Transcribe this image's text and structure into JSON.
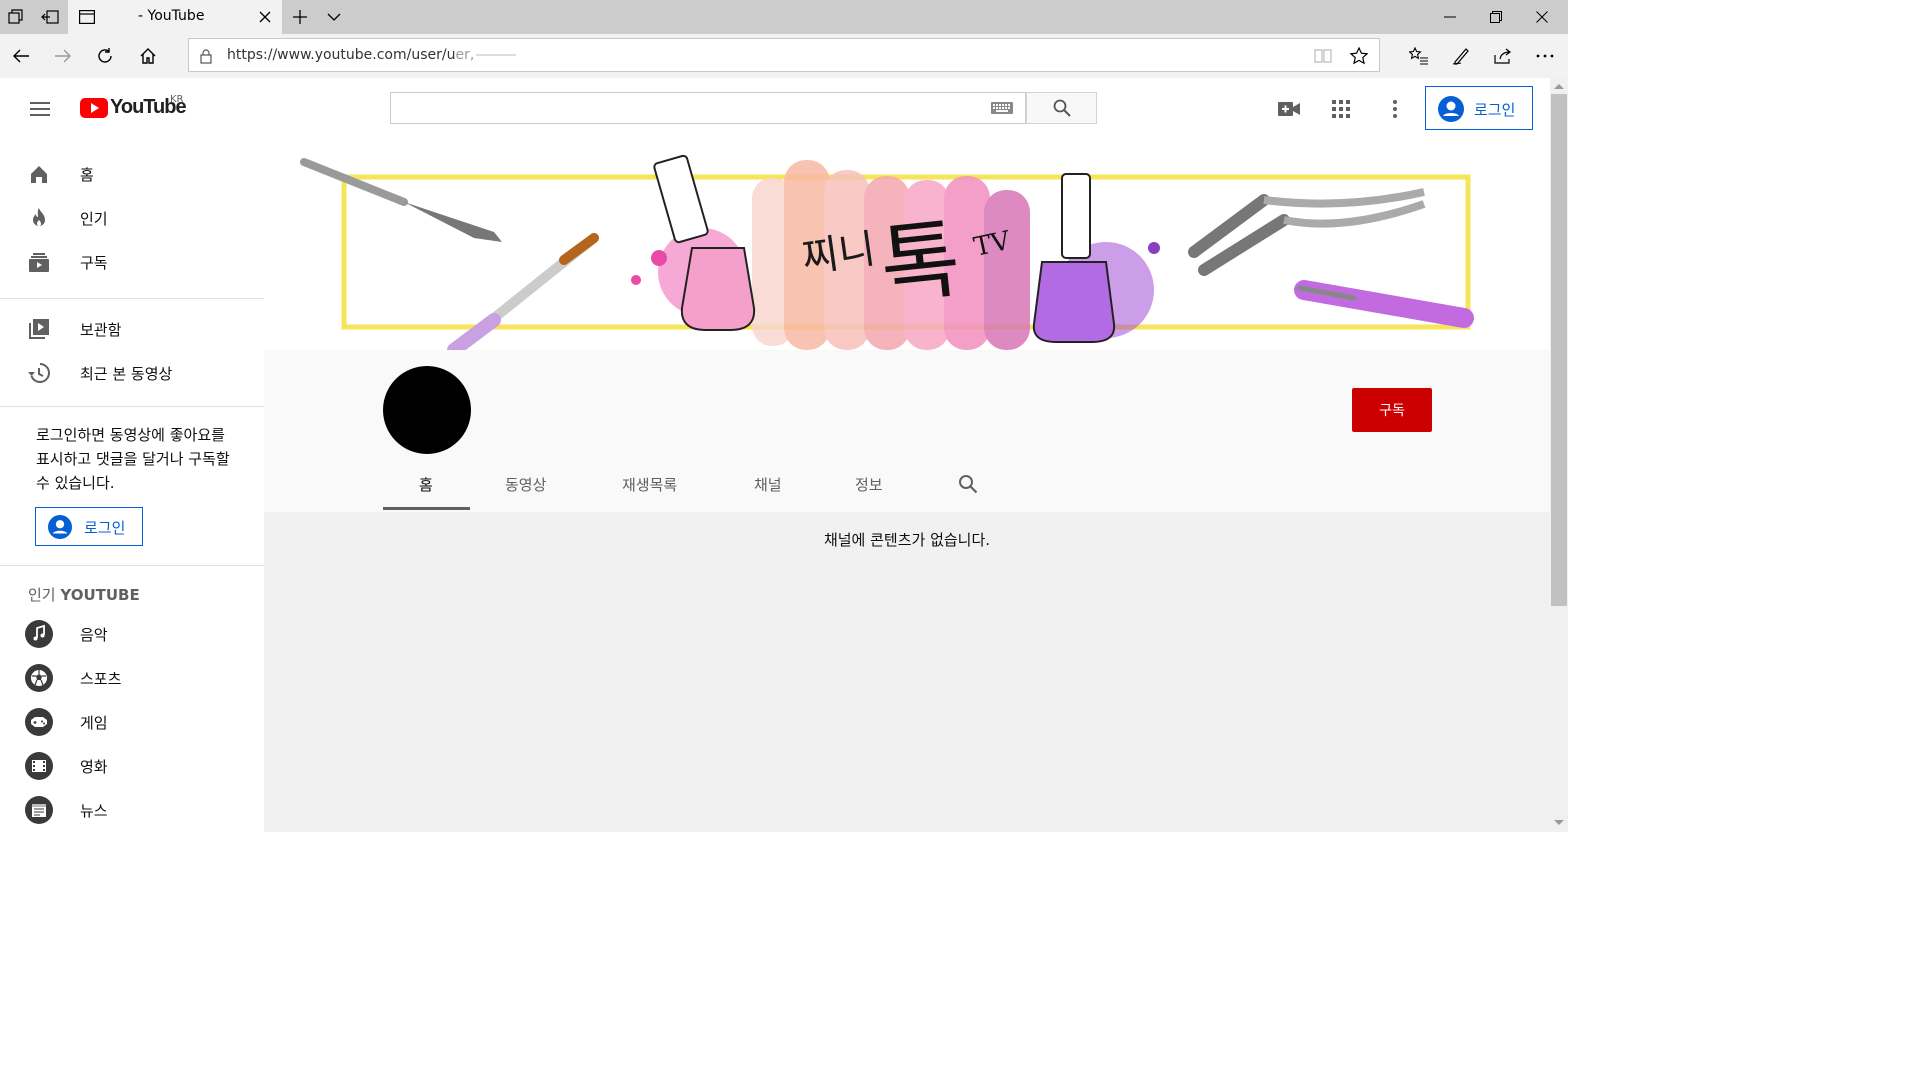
{
  "browser": {
    "tab_title": "- YouTube",
    "url": "https://www.youtube.com/user/u",
    "url_faded": "er,"
  },
  "masthead": {
    "logo_text": "YouTube",
    "region": "KR",
    "search_placeholder": "",
    "signin_label": "로그인"
  },
  "sidebar": {
    "main_items": [
      {
        "label": "홈",
        "icon": "home-icon"
      },
      {
        "label": "인기",
        "icon": "fire-icon"
      },
      {
        "label": "구독",
        "icon": "subscriptions-icon"
      }
    ],
    "library_items": [
      {
        "label": "보관함",
        "icon": "library-icon"
      },
      {
        "label": "최근 본 동영상",
        "icon": "history-icon"
      }
    ],
    "signin_prompt": "로그인하면 동영상에 좋아요를 표시하고 댓글을 달거나 구독할 수 있습니다.",
    "signin_label": "로그인",
    "section_title_prefix": "인기 ",
    "section_title_brand": "YOUTUBE",
    "popular_items": [
      {
        "label": "음악",
        "icon": "music-icon"
      },
      {
        "label": "스포츠",
        "icon": "sports-icon"
      },
      {
        "label": "게임",
        "icon": "gaming-icon"
      },
      {
        "label": "영화",
        "icon": "movies-icon"
      },
      {
        "label": "뉴스",
        "icon": "news-icon"
      }
    ]
  },
  "channel": {
    "banner_title_a": "찌니",
    "banner_title_b": "톡",
    "banner_title_c": "TV",
    "subscribe_label": "구독",
    "tabs": [
      {
        "label": "홈",
        "active": true
      },
      {
        "label": "동영상",
        "active": false
      },
      {
        "label": "재생목록",
        "active": false
      },
      {
        "label": "채널",
        "active": false
      },
      {
        "label": "정보",
        "active": false
      }
    ],
    "empty_message": "채널에 콘텐츠가 없습니다."
  },
  "colors": {
    "youtube_red": "#ff0000",
    "subscribe_red": "#cc0000",
    "link_blue": "#065fd4"
  }
}
